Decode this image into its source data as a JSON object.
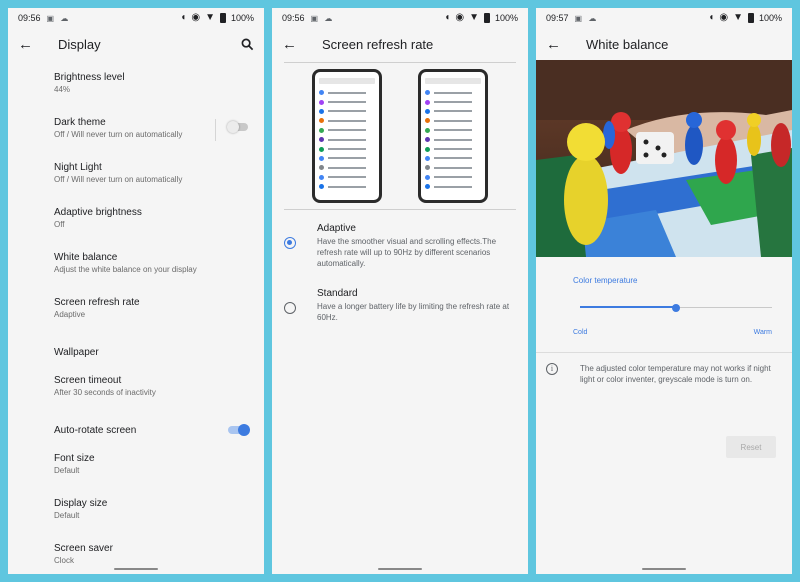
{
  "status_bars": [
    {
      "time": "09:56",
      "battery": "100%"
    },
    {
      "time": "09:56",
      "battery": "100%"
    },
    {
      "time": "09:57",
      "battery": "100%"
    }
  ],
  "display_screen": {
    "title": "Display",
    "items": [
      {
        "title": "Brightness level",
        "subtitle": "44%"
      },
      {
        "title": "Dark theme",
        "subtitle": "Off / Will never turn on automatically",
        "toggle": "off"
      },
      {
        "title": "Night Light",
        "subtitle": "Off / Will never turn on automatically"
      },
      {
        "title": "Adaptive brightness",
        "subtitle": "Off"
      },
      {
        "title": "White balance",
        "subtitle": "Adjust the white balance on your display"
      },
      {
        "title": "Screen refresh rate",
        "subtitle": "Adaptive"
      },
      {
        "title": "Wallpaper"
      },
      {
        "title": "Screen timeout",
        "subtitle": "After 30 seconds of inactivity"
      },
      {
        "title": "Auto-rotate screen",
        "toggle": "on"
      },
      {
        "title": "Font size",
        "subtitle": "Default"
      },
      {
        "title": "Display size",
        "subtitle": "Default"
      },
      {
        "title": "Screen saver",
        "subtitle": "Clock"
      }
    ]
  },
  "refresh_screen": {
    "title": "Screen refresh rate",
    "options": [
      {
        "title": "Adaptive",
        "description": "Have the smoother visual and scrolling effects.The refresh rate will up to 90Hz by different scenarios automatically.",
        "selected": true
      },
      {
        "title": "Standard",
        "description": "Have a longer battery life by limiting the refresh rate at 60Hz.",
        "selected": false
      }
    ]
  },
  "white_balance_screen": {
    "title": "White balance",
    "color_temperature_label": "Color temperature",
    "slider_value_fraction": 0.5,
    "cold_label": "Cold",
    "warm_label": "Warm",
    "info_text": "The adjusted color temperature may not works if night light or color inventer, greyscale mode is turn on.",
    "reset_label": "Reset"
  },
  "colors": {
    "accent": "#3d7be0",
    "background": "#5fc6df",
    "screen": "#f5f5f5"
  }
}
